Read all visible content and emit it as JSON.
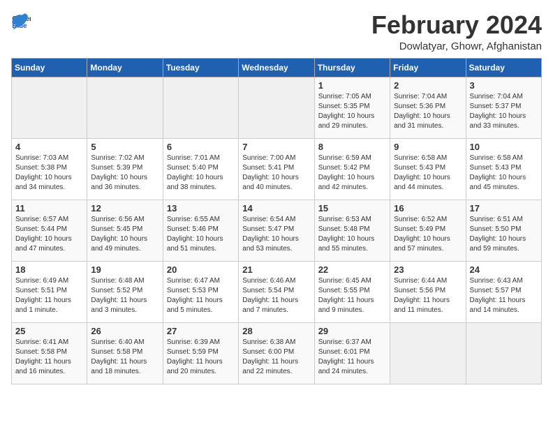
{
  "header": {
    "logo_general": "General",
    "logo_blue": "Blue",
    "title": "February 2024",
    "subtitle": "Dowlatyar, Ghowr, Afghanistan"
  },
  "weekdays": [
    "Sunday",
    "Monday",
    "Tuesday",
    "Wednesday",
    "Thursday",
    "Friday",
    "Saturday"
  ],
  "weeks": [
    [
      {
        "day": "",
        "info": ""
      },
      {
        "day": "",
        "info": ""
      },
      {
        "day": "",
        "info": ""
      },
      {
        "day": "",
        "info": ""
      },
      {
        "day": "1",
        "info": "Sunrise: 7:05 AM\nSunset: 5:35 PM\nDaylight: 10 hours\nand 29 minutes."
      },
      {
        "day": "2",
        "info": "Sunrise: 7:04 AM\nSunset: 5:36 PM\nDaylight: 10 hours\nand 31 minutes."
      },
      {
        "day": "3",
        "info": "Sunrise: 7:04 AM\nSunset: 5:37 PM\nDaylight: 10 hours\nand 33 minutes."
      }
    ],
    [
      {
        "day": "4",
        "info": "Sunrise: 7:03 AM\nSunset: 5:38 PM\nDaylight: 10 hours\nand 34 minutes."
      },
      {
        "day": "5",
        "info": "Sunrise: 7:02 AM\nSunset: 5:39 PM\nDaylight: 10 hours\nand 36 minutes."
      },
      {
        "day": "6",
        "info": "Sunrise: 7:01 AM\nSunset: 5:40 PM\nDaylight: 10 hours\nand 38 minutes."
      },
      {
        "day": "7",
        "info": "Sunrise: 7:00 AM\nSunset: 5:41 PM\nDaylight: 10 hours\nand 40 minutes."
      },
      {
        "day": "8",
        "info": "Sunrise: 6:59 AM\nSunset: 5:42 PM\nDaylight: 10 hours\nand 42 minutes."
      },
      {
        "day": "9",
        "info": "Sunrise: 6:58 AM\nSunset: 5:43 PM\nDaylight: 10 hours\nand 44 minutes."
      },
      {
        "day": "10",
        "info": "Sunrise: 6:58 AM\nSunset: 5:43 PM\nDaylight: 10 hours\nand 45 minutes."
      }
    ],
    [
      {
        "day": "11",
        "info": "Sunrise: 6:57 AM\nSunset: 5:44 PM\nDaylight: 10 hours\nand 47 minutes."
      },
      {
        "day": "12",
        "info": "Sunrise: 6:56 AM\nSunset: 5:45 PM\nDaylight: 10 hours\nand 49 minutes."
      },
      {
        "day": "13",
        "info": "Sunrise: 6:55 AM\nSunset: 5:46 PM\nDaylight: 10 hours\nand 51 minutes."
      },
      {
        "day": "14",
        "info": "Sunrise: 6:54 AM\nSunset: 5:47 PM\nDaylight: 10 hours\nand 53 minutes."
      },
      {
        "day": "15",
        "info": "Sunrise: 6:53 AM\nSunset: 5:48 PM\nDaylight: 10 hours\nand 55 minutes."
      },
      {
        "day": "16",
        "info": "Sunrise: 6:52 AM\nSunset: 5:49 PM\nDaylight: 10 hours\nand 57 minutes."
      },
      {
        "day": "17",
        "info": "Sunrise: 6:51 AM\nSunset: 5:50 PM\nDaylight: 10 hours\nand 59 minutes."
      }
    ],
    [
      {
        "day": "18",
        "info": "Sunrise: 6:49 AM\nSunset: 5:51 PM\nDaylight: 11 hours\nand 1 minute."
      },
      {
        "day": "19",
        "info": "Sunrise: 6:48 AM\nSunset: 5:52 PM\nDaylight: 11 hours\nand 3 minutes."
      },
      {
        "day": "20",
        "info": "Sunrise: 6:47 AM\nSunset: 5:53 PM\nDaylight: 11 hours\nand 5 minutes."
      },
      {
        "day": "21",
        "info": "Sunrise: 6:46 AM\nSunset: 5:54 PM\nDaylight: 11 hours\nand 7 minutes."
      },
      {
        "day": "22",
        "info": "Sunrise: 6:45 AM\nSunset: 5:55 PM\nDaylight: 11 hours\nand 9 minutes."
      },
      {
        "day": "23",
        "info": "Sunrise: 6:44 AM\nSunset: 5:56 PM\nDaylight: 11 hours\nand 11 minutes."
      },
      {
        "day": "24",
        "info": "Sunrise: 6:43 AM\nSunset: 5:57 PM\nDaylight: 11 hours\nand 14 minutes."
      }
    ],
    [
      {
        "day": "25",
        "info": "Sunrise: 6:41 AM\nSunset: 5:58 PM\nDaylight: 11 hours\nand 16 minutes."
      },
      {
        "day": "26",
        "info": "Sunrise: 6:40 AM\nSunset: 5:58 PM\nDaylight: 11 hours\nand 18 minutes."
      },
      {
        "day": "27",
        "info": "Sunrise: 6:39 AM\nSunset: 5:59 PM\nDaylight: 11 hours\nand 20 minutes."
      },
      {
        "day": "28",
        "info": "Sunrise: 6:38 AM\nSunset: 6:00 PM\nDaylight: 11 hours\nand 22 minutes."
      },
      {
        "day": "29",
        "info": "Sunrise: 6:37 AM\nSunset: 6:01 PM\nDaylight: 11 hours\nand 24 minutes."
      },
      {
        "day": "",
        "info": ""
      },
      {
        "day": "",
        "info": ""
      }
    ]
  ]
}
